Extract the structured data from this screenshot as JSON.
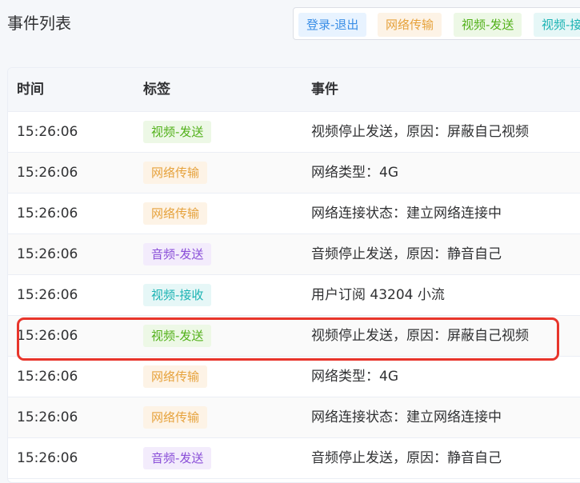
{
  "page_title": "事件列表",
  "filter_tags": [
    {
      "label": "登录-退出",
      "text_color": "#3a8ee6",
      "bg_color": "#e8f3ff"
    },
    {
      "label": "网络传输",
      "text_color": "#e6a23c",
      "bg_color": "#fdf3e6"
    },
    {
      "label": "视频-发送",
      "text_color": "#52b11a",
      "bg_color": "#edf8e6"
    },
    {
      "label": "视频-接收",
      "text_color": "#1bb3b3",
      "bg_color": "#e6f7f7"
    }
  ],
  "table": {
    "headers": {
      "time": "时间",
      "tag": "标签",
      "event": "事件"
    },
    "rows": [
      {
        "time": "15:26:06",
        "tag": "视频-发送",
        "tag_color": "#52b11a",
        "tag_bg": "#edf8e6",
        "event": "视频停止发送，原因：屏蔽自己视频"
      },
      {
        "time": "15:26:06",
        "tag": "网络传输",
        "tag_color": "#e6a23c",
        "tag_bg": "#fdf3e6",
        "event": "网络类型：4G"
      },
      {
        "time": "15:26:06",
        "tag": "网络传输",
        "tag_color": "#e6a23c",
        "tag_bg": "#fdf3e6",
        "event": "网络连接状态：建立网络连接中"
      },
      {
        "time": "15:26:06",
        "tag": "音频-发送",
        "tag_color": "#8a4fd8",
        "tag_bg": "#f3ecfc",
        "event": "音频停止发送，原因：静音自己"
      },
      {
        "time": "15:26:06",
        "tag": "视频-接收",
        "tag_color": "#1bb3b3",
        "tag_bg": "#e6f7f7",
        "event": "用户订阅 43204 小流"
      },
      {
        "time": "15:26:06",
        "tag": "视频-发送",
        "tag_color": "#52b11a",
        "tag_bg": "#edf8e6",
        "event": "视频停止发送，原因：屏蔽自己视频"
      },
      {
        "time": "15:26:06",
        "tag": "网络传输",
        "tag_color": "#e6a23c",
        "tag_bg": "#fdf3e6",
        "event": "网络类型：4G"
      },
      {
        "time": "15:26:06",
        "tag": "网络传输",
        "tag_color": "#e6a23c",
        "tag_bg": "#fdf3e6",
        "event": "网络连接状态：建立网络连接中"
      },
      {
        "time": "15:26:06",
        "tag": "音频-发送",
        "tag_color": "#8a4fd8",
        "tag_bg": "#f3ecfc",
        "event": "音频停止发送，原因：静音自己"
      }
    ]
  },
  "highlight_color": "#e8352b"
}
